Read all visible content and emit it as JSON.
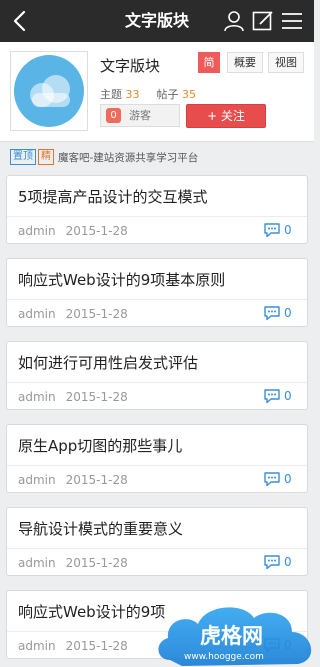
{
  "topbar": {
    "title": "文字版块"
  },
  "forum": {
    "name": "文字版块",
    "tags": {
      "simplified": "简",
      "overview": "概要",
      "view": "视图"
    },
    "stats": {
      "topics_label": "主题",
      "topics": "33",
      "posts_label": "帖子",
      "posts": "35"
    },
    "guest": {
      "count": "0",
      "label": "游客"
    },
    "follow_label": "+ 关注"
  },
  "notice": {
    "badge_top": "置顶",
    "badge_fine": "精",
    "text": "魔客吧-建站资源共享学习平台"
  },
  "posts": [
    {
      "title": "5项提高产品设计的交互模式",
      "author": "admin",
      "date": "2015-1-28",
      "comments": "0"
    },
    {
      "title": "响应式Web设计的9项基本原则",
      "author": "admin",
      "date": "2015-1-28",
      "comments": "0"
    },
    {
      "title": "如何进行可用性启发式评估",
      "author": "admin",
      "date": "2015-1-28",
      "comments": "0"
    },
    {
      "title": "原生App切图的那些事儿",
      "author": "admin",
      "date": "2015-1-28",
      "comments": "0"
    },
    {
      "title": "导航设计模式的重要意义",
      "author": "admin",
      "date": "2015-1-28",
      "comments": "0"
    },
    {
      "title": "响应式Web设计的9项",
      "author": "admin",
      "date": "2015-1-28",
      "comments": "0"
    }
  ],
  "watermark": {
    "name": "虎格网",
    "url": "www.hoogge.com"
  },
  "colors": {
    "accent_red": "#e84d4d",
    "link_blue": "#3a8fd8",
    "count_orange": "#e68a2e",
    "topbar": "#2b2b2b"
  }
}
